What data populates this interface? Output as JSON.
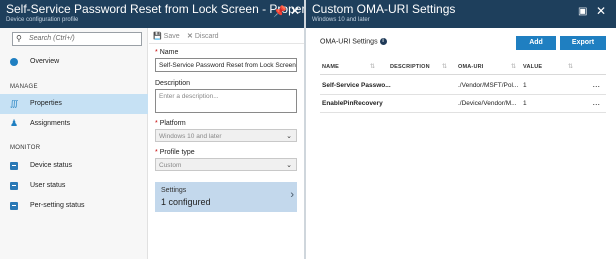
{
  "left_blade": {
    "title": "Self-Service Password Reset from Lock Screen - Properties",
    "subtitle": "Device configuration profile",
    "pin_icon": "pin-icon",
    "close_icon": "close-icon"
  },
  "nav": {
    "search_placeholder": "Search (Ctrl+/)",
    "overview": "Overview",
    "manage_section": "MANAGE",
    "properties": "Properties",
    "assignments": "Assignments",
    "monitor_section": "MONITOR",
    "device_status": "Device status",
    "user_status": "User status",
    "per_setting_status": "Per-setting status"
  },
  "toolbar": {
    "save_label": "Save",
    "discard_label": "Discard"
  },
  "form": {
    "name_label": "Name",
    "name_value": "Self-Service Password Reset from Lock Screen",
    "description_label": "Description",
    "description_placeholder": "Enter a description...",
    "platform_label": "Platform",
    "platform_value": "Windows 10 and later",
    "profile_type_label": "Profile type",
    "profile_type_value": "Custom",
    "settings_label": "Settings",
    "settings_value": "1 configured"
  },
  "right_blade": {
    "title": "Custom OMA-URI Settings",
    "subtitle": "Windows 10 and later",
    "oma_label": "OMA-URI Settings",
    "add_label": "Add",
    "export_label": "Export",
    "columns": [
      "NAME",
      "DESCRIPTION",
      "OMA-URI",
      "VALUE"
    ],
    "rows": [
      {
        "name": "Self-Service Passwo...",
        "description": "",
        "uri": "./Vendor/MSFT/Pol...",
        "value": "1"
      },
      {
        "name": "EnablePinRecovery",
        "description": "",
        "uri": "./Device/Vendor/M...",
        "value": "1"
      }
    ],
    "more_label": "..."
  },
  "colors": {
    "header_bg": "#1e3f5c",
    "accent": "#1f7fc1",
    "selected_nav": "#c6e1f4",
    "settings_card": "#c3d8ec"
  }
}
